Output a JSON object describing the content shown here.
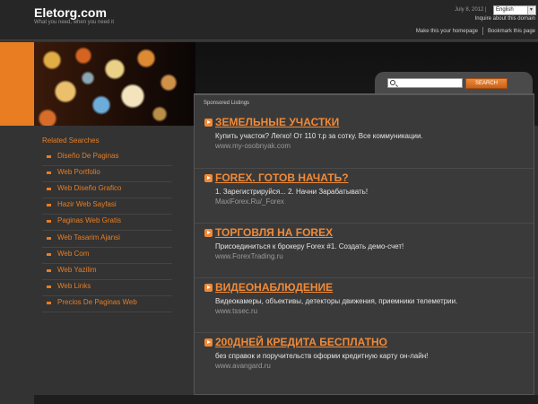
{
  "header": {
    "site_name": "Eletorg.com",
    "tagline": "What you need, when you need it",
    "date": "July 8, 2012 |",
    "language": "English",
    "inquire": "Inquire about this domain",
    "homepage_link": "Make this your homepage",
    "bookmark_link": "Bookmark this page"
  },
  "search": {
    "placeholder": "",
    "button_label": "SEARCH"
  },
  "sidebar": {
    "title": "Related Searches",
    "items": [
      "Diseño De Paginas",
      "Web Portfolio",
      "Web Diseño Grafico",
      "Hazir Web Sayfasi",
      "Paginas Web Gratis",
      "Web Tasarim Ajansi",
      "Web Com",
      "Web Yazilim",
      "Web Links",
      "Precios De Paginas Web"
    ]
  },
  "main": {
    "sponsored_label": "Sponsored Listings",
    "listings": [
      {
        "title": "ЗЕМЕЛЬНЫЕ УЧАСТКИ",
        "desc": "Купить участок? Легко! От 110 т.р за сотку. Все коммуникации.",
        "url": "www.my-osobnyak.com"
      },
      {
        "title": "FOREX. ГОТОВ НАЧАТЬ?",
        "desc": "1. Зарегистрируйся... 2. Начни Зарабатывать!",
        "url": "MaxiForex.Ru/_Forex"
      },
      {
        "title": "ТОРГОВЛЯ НА FOREX",
        "desc": "Присоединиться к брокеру Forex #1. Создать демо-счет!",
        "url": "www.ForexTrading.ru"
      },
      {
        "title": "ВИДЕОНАБЛЮДЕНИЕ",
        "desc": "Видеокамеры, объективы, детекторы движения, приемники телеметрии.",
        "url": "www.tssec.ru"
      },
      {
        "title": "200ДНЕЙ КРЕДИТА БЕСПЛАТНО",
        "desc": "без справок и поручительств оформи кредитную карту он-лайн!",
        "url": "www.avangard.ru"
      }
    ]
  },
  "colors": {
    "accent": "#e87d22",
    "background": "#333333",
    "header": "#262626"
  }
}
